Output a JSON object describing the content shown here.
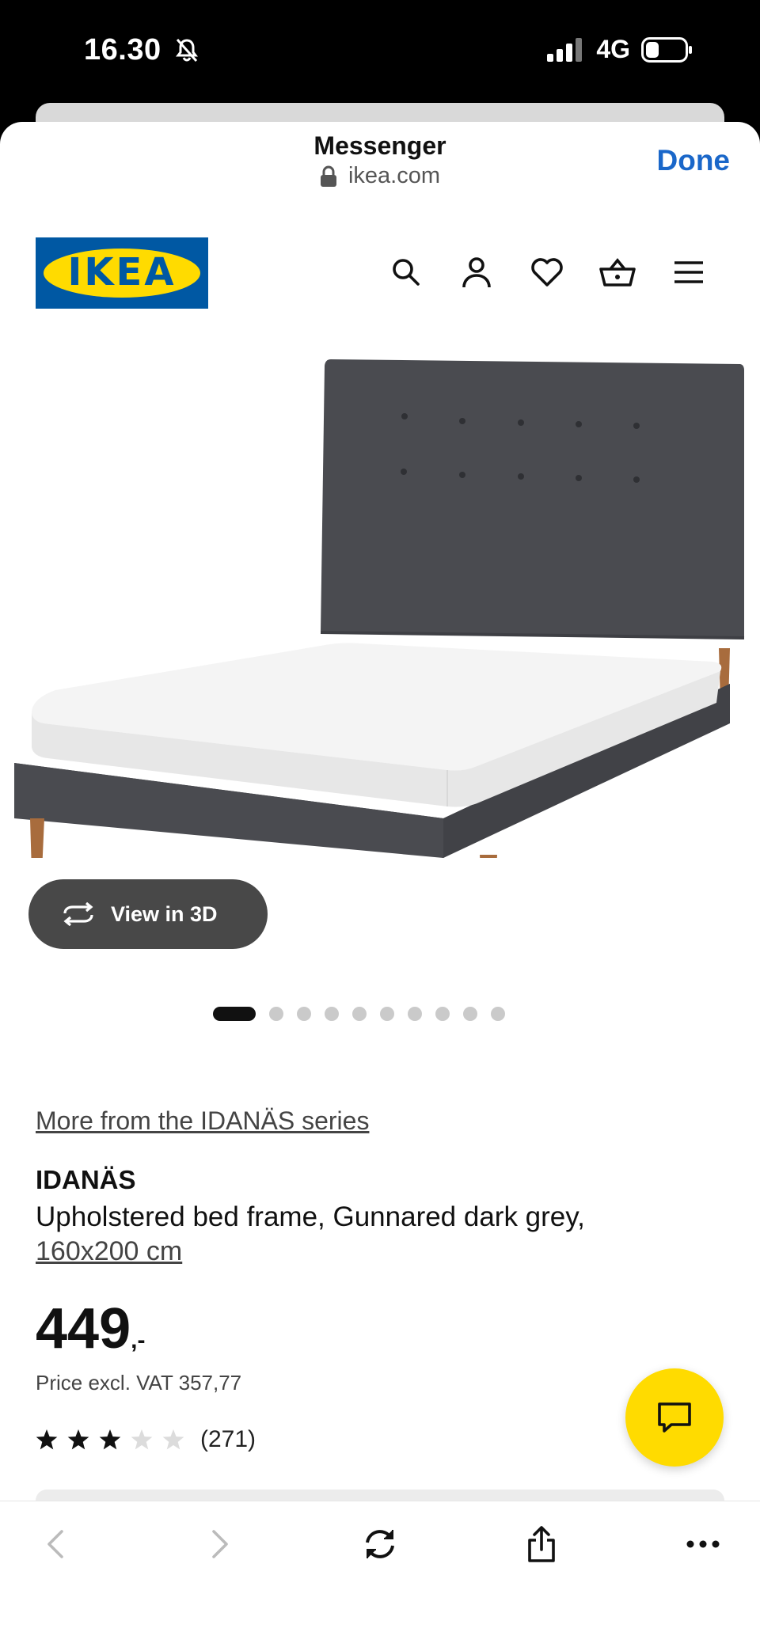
{
  "status_bar": {
    "time": "16.30",
    "network": "4G"
  },
  "browser": {
    "app_title": "Messenger",
    "url": "ikea.com",
    "done_label": "Done"
  },
  "header": {
    "logo_text": "IKEA",
    "icons": [
      "search-icon",
      "account-icon",
      "heart-icon",
      "basket-icon",
      "menu-icon"
    ]
  },
  "gallery": {
    "view_3d_label": "View in 3D",
    "image_count": 10,
    "active_index": 0
  },
  "product": {
    "series_link": "More from the IDANÄS series",
    "name": "IDANÄS",
    "description": "Upholstered bed frame, Gunnared dark grey,",
    "size": "160x200 cm",
    "price": "449",
    "price_suffix": ",-",
    "price_excl_vat": "Price excl. VAT 357,77",
    "rating": 3,
    "rating_max": 5,
    "review_count": "(271)"
  },
  "colors": {
    "ikea_blue": "#0058a3",
    "ikea_yellow": "#ffdb00",
    "done_blue": "#1a67c9",
    "bed_fabric": "#4a4b50"
  }
}
